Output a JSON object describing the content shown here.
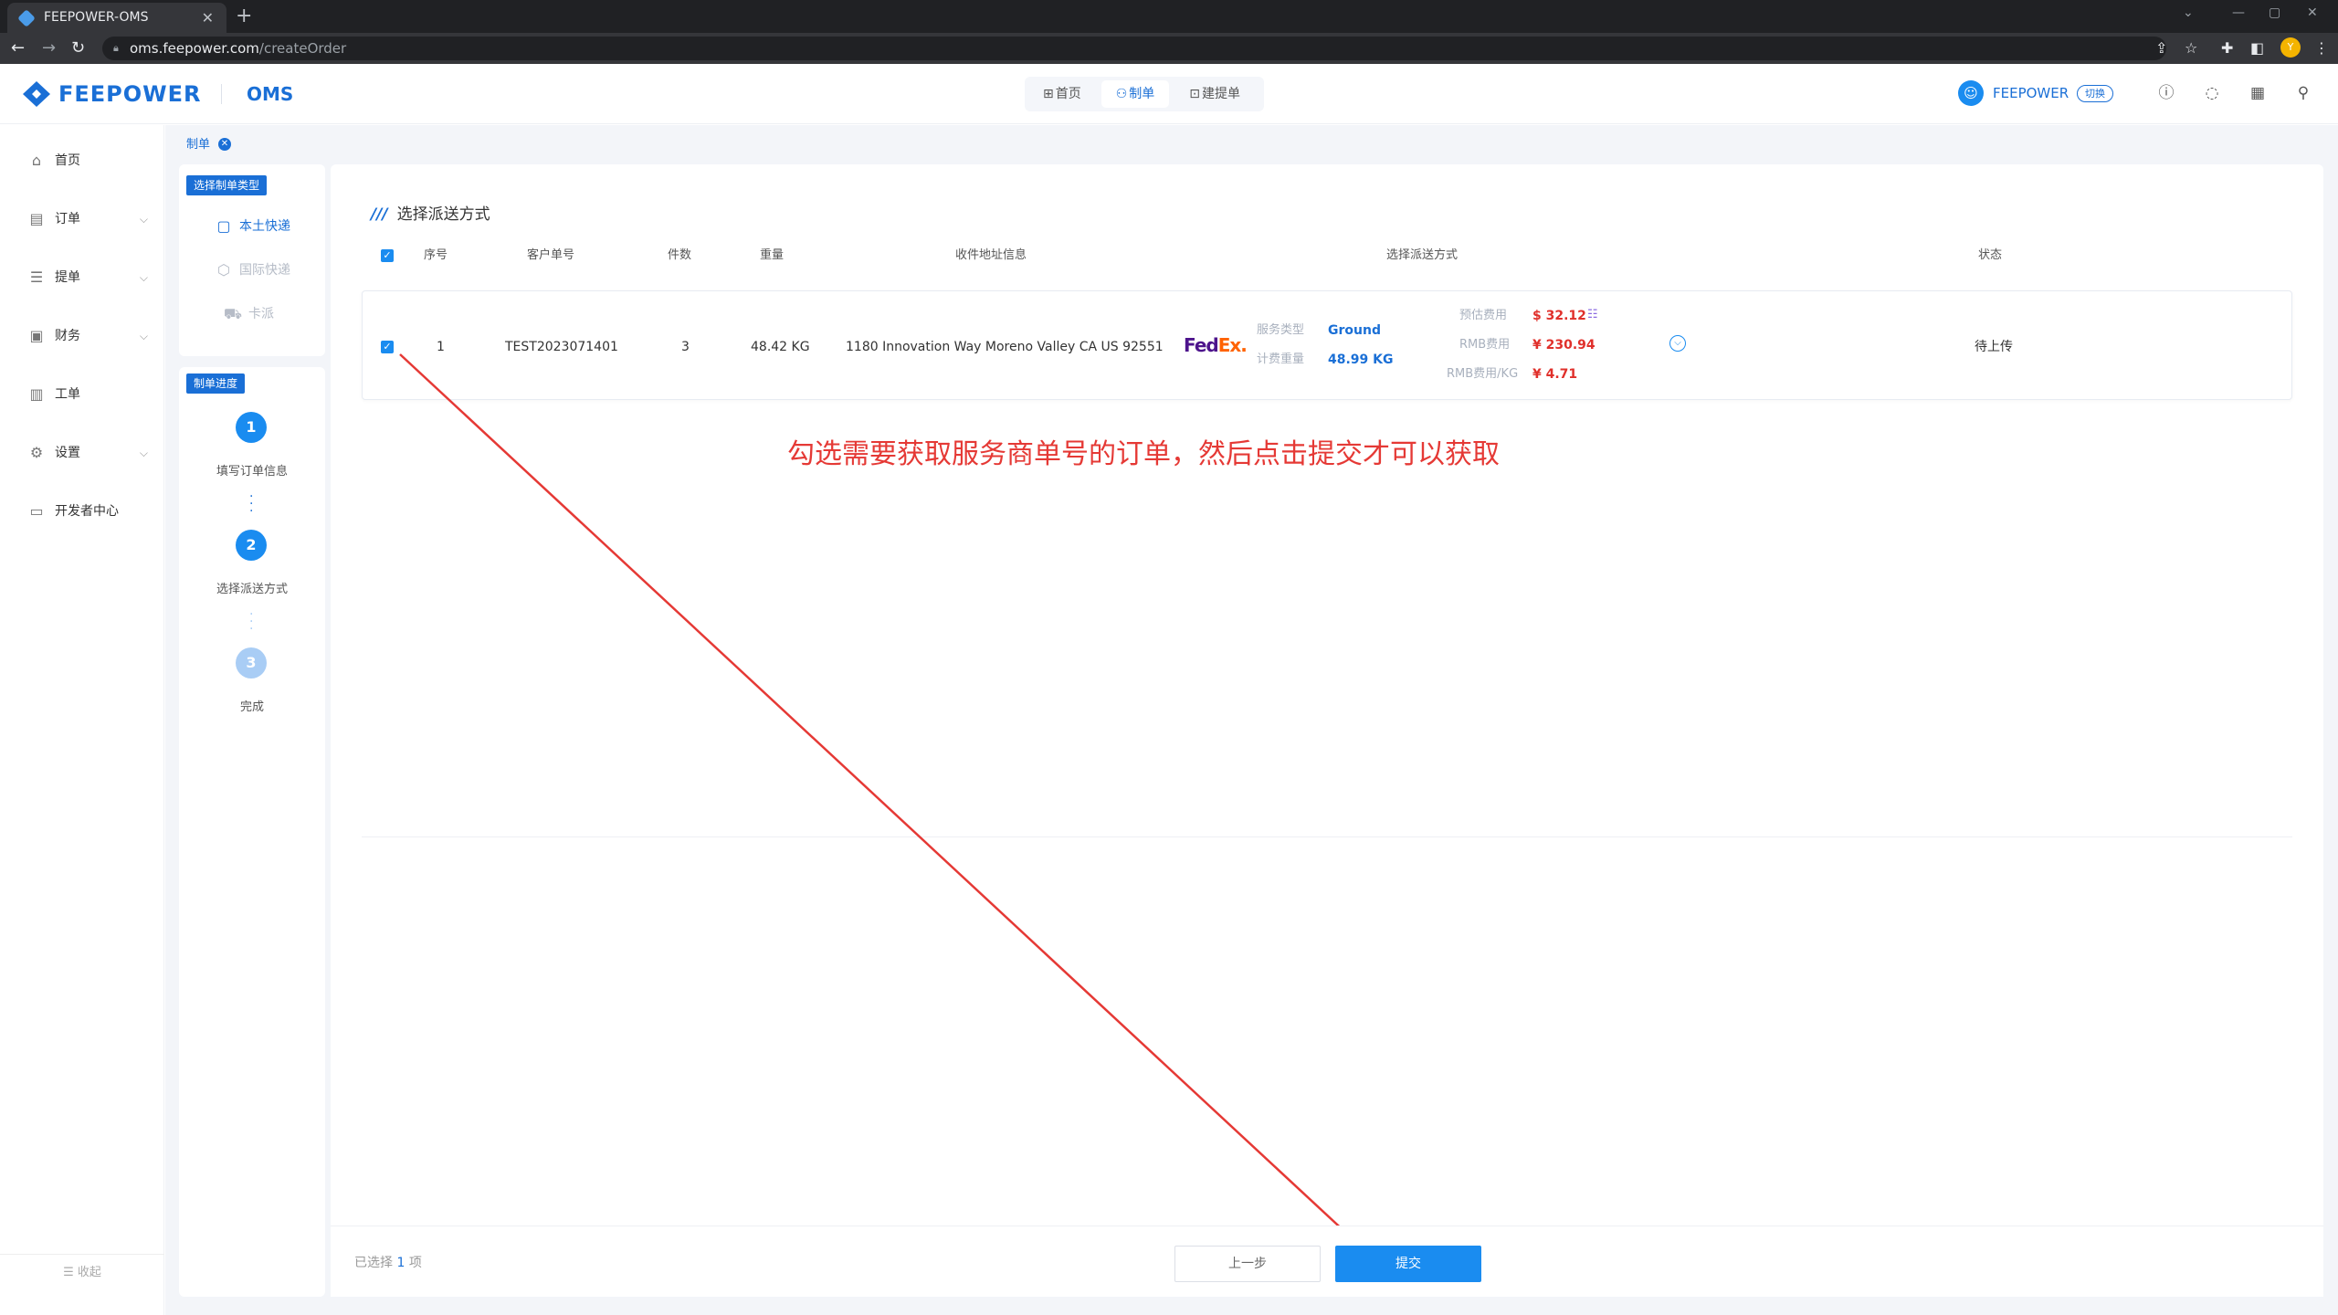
{
  "browser": {
    "tab_title": "FEEPOWER-OMS",
    "tab_close": "✕",
    "new_tab": "+",
    "url_host": "oms.feepower.com",
    "url_path": "/createOrder",
    "window_min": "—",
    "window_max": "▢",
    "window_close": "✕",
    "profile_letter": "Y"
  },
  "header": {
    "logo": "FEEPOWER",
    "product": "OMS",
    "nav": [
      {
        "label": "首页"
      },
      {
        "label": "制单"
      },
      {
        "label": "建提单"
      }
    ],
    "user_name": "FEEPOWER",
    "switch_label": "切换"
  },
  "sidebar": {
    "items": [
      {
        "label": "首页"
      },
      {
        "label": "订单"
      },
      {
        "label": "提单"
      },
      {
        "label": "财务"
      },
      {
        "label": "工单"
      },
      {
        "label": "设置"
      },
      {
        "label": "开发者中心"
      }
    ],
    "collapse_label": "收起"
  },
  "breadcrumb": {
    "label": "制单"
  },
  "order_type": {
    "title": "选择制单类型",
    "options": [
      {
        "label": "本土快递"
      },
      {
        "label": "国际快递"
      },
      {
        "label": "卡派"
      }
    ]
  },
  "progress": {
    "title": "制单进度",
    "steps": [
      {
        "num": "1",
        "label": "填写订单信息"
      },
      {
        "num": "2",
        "label": "选择派送方式"
      },
      {
        "num": "3",
        "label": "完成"
      }
    ]
  },
  "section": {
    "title": "选择派送方式"
  },
  "table": {
    "headers": {
      "seq": "序号",
      "customer_no": "客户单号",
      "pieces": "件数",
      "weight": "重量",
      "address": "收件地址信息",
      "delivery": "选择派送方式",
      "status": "状态"
    },
    "rows": [
      {
        "seq": "1",
        "customer_no": "TEST2023071401",
        "pieces": "3",
        "weight": "48.42 KG",
        "address": "1180 Innovation Way Moreno Valley CA US 92551",
        "carrier_fed": "Fed",
        "carrier_ex": "Ex.",
        "service_type_label": "服务类型",
        "service_type": "Ground",
        "billing_weight_label": "计费重量",
        "billing_weight": "48.99 KG",
        "est_fee_label": "预估费用",
        "est_fee": "$ 32.12",
        "rmb_fee_label": "RMB费用",
        "rmb_fee": "¥ 230.94",
        "rmb_per_kg_label": "RMB费用/KG",
        "rmb_per_kg": "¥ 4.71",
        "status": "待上传"
      }
    ]
  },
  "annotation": "勾选需要获取服务商单号的订单，然后点击提交才可以获取",
  "footer": {
    "selected_prefix": "已选择",
    "selected_count": "1",
    "selected_suffix": "项",
    "prev_label": "上一步",
    "submit_label": "提交"
  },
  "colors": {
    "brand": "#1a6fd6",
    "primary_button": "#1a8cf0",
    "price_red": "#e0302b",
    "annotation_red": "#e53935"
  }
}
